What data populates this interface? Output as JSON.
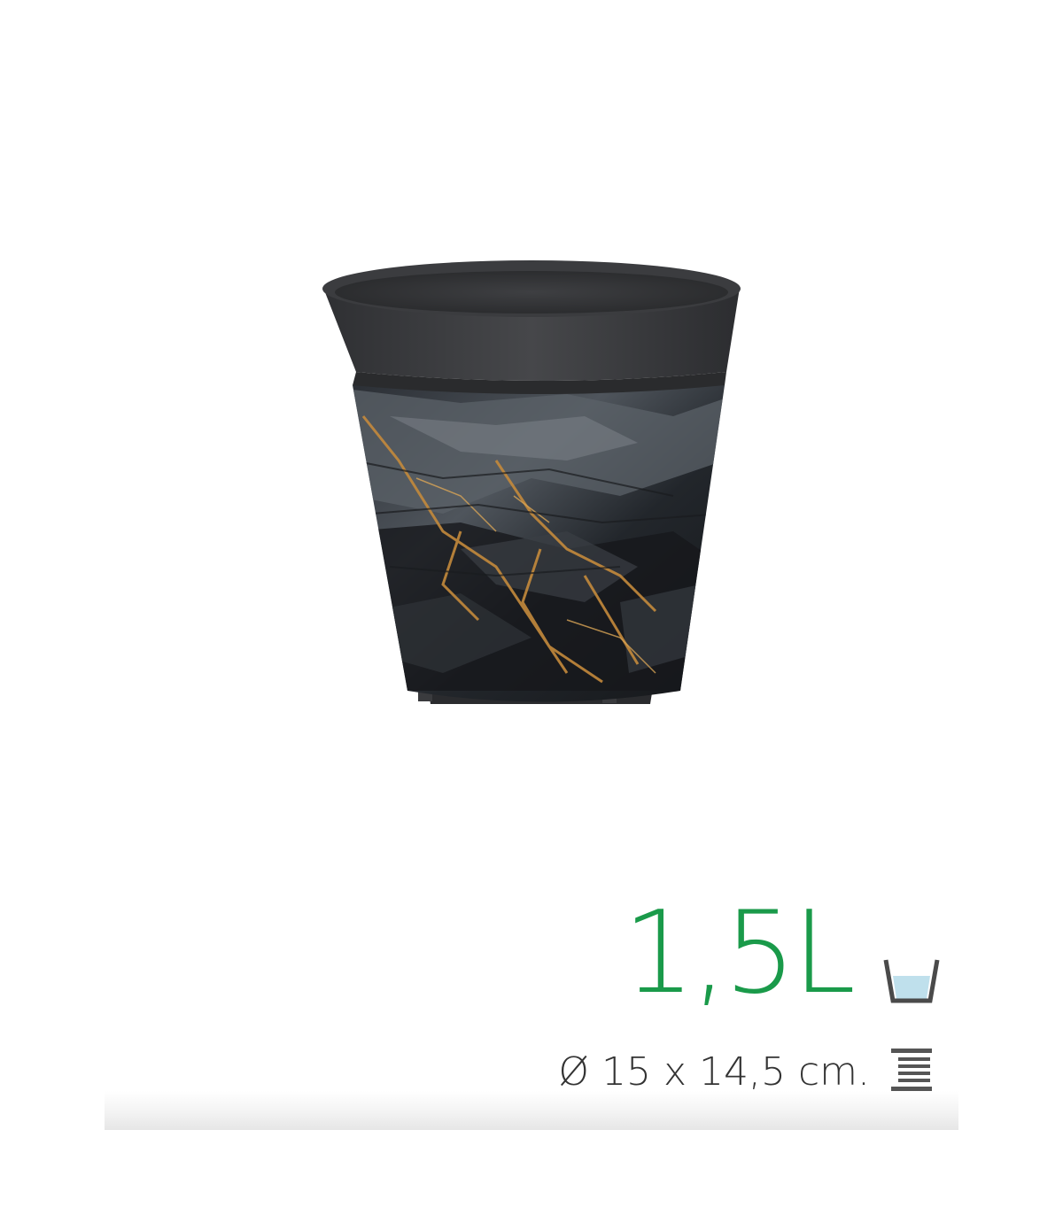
{
  "product": {
    "capacity": "1,5L",
    "dimensions": "Ø 15 x 14,5 cm."
  },
  "colors": {
    "capacity_text": "#1a9a4a",
    "dimension_text": "#333333",
    "pot_rim": "#3a3b3d",
    "pot_body": "#24272b",
    "vein_gold": "#c48a3c",
    "cup_water": "#bfe0ec"
  },
  "icons": {
    "capacity": "cup-icon",
    "dimensions": "height-icon"
  }
}
